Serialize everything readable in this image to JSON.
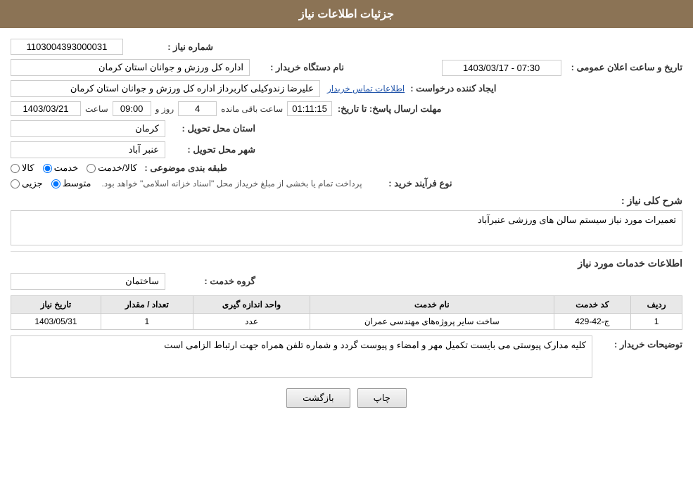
{
  "header": {
    "title": "جزئیات اطلاعات نیاز"
  },
  "fields": {
    "need_number_label": "شماره نیاز :",
    "need_number_value": "1103004393000031",
    "buyer_org_label": "نام دستگاه خریدار :",
    "buyer_org_value": "اداره کل ورزش و جوانان استان کرمان",
    "announce_date_label": "تاریخ و ساعت اعلان عمومی :",
    "announce_date_value": "1403/03/17 - 07:30",
    "creator_label": "ایجاد کننده درخواست :",
    "creator_value": "علیرضا  زندوکیلی  کاربرداز اداره کل ورزش و جوانان استان کرمان",
    "contact_link": "اطلاعات تماس خریدار",
    "deadline_label": "مهلت ارسال پاسخ: تا تاریخ:",
    "deadline_date": "1403/03/21",
    "deadline_time_label": "ساعت",
    "deadline_time": "09:00",
    "deadline_days_label": "روز و",
    "deadline_days": "4",
    "remaining_label": "ساعت باقی مانده",
    "remaining_time": "01:11:15",
    "province_label": "استان محل تحویل :",
    "province_value": "کرمان",
    "city_label": "شهر محل تحویل :",
    "city_value": "عنبر آباد",
    "category_label": "طبقه بندی موضوعی :",
    "category_options": [
      {
        "label": "کالا",
        "checked": false
      },
      {
        "label": "خدمت",
        "checked": true
      },
      {
        "label": "کالا/خدمت",
        "checked": false
      }
    ],
    "purchase_type_label": "نوع فرآیند خرید :",
    "purchase_type_options": [
      {
        "label": "جزیی",
        "checked": false
      },
      {
        "label": "متوسط",
        "checked": true
      }
    ],
    "purchase_type_note": "پرداخت تمام یا بخشی از مبلغ خریداز محل \"اسناد خزانه اسلامی\" خواهد بود.",
    "need_description_label": "شرح کلی نیاز :",
    "need_description_value": "تعمیرات مورد نیاز سیستم سالن های ورزشی عنبرآباد",
    "services_section_title": "اطلاعات خدمات مورد نیاز",
    "service_group_label": "گروه خدمت :",
    "service_group_value": "ساختمان",
    "table": {
      "headers": [
        "ردیف",
        "کد خدمت",
        "نام خدمت",
        "واحد اندازه گیری",
        "تعداد / مقدار",
        "تاریخ نیاز"
      ],
      "rows": [
        {
          "row": "1",
          "code": "ج-42-429",
          "name": "ساخت سایر پروژه‌های مهندسی عمران",
          "unit": "عدد",
          "qty": "1",
          "date": "1403/05/31"
        }
      ]
    },
    "buyer_notes_label": "توضیحات خریدار :",
    "buyer_notes_value": "کلیه مدارک پیوستی می بایست تکمیل مهر و امضاء و پیوست گردد و شماره تلفن همراه جهت ارتباط الزامی است"
  },
  "buttons": {
    "print_label": "چاپ",
    "back_label": "بازگشت"
  }
}
